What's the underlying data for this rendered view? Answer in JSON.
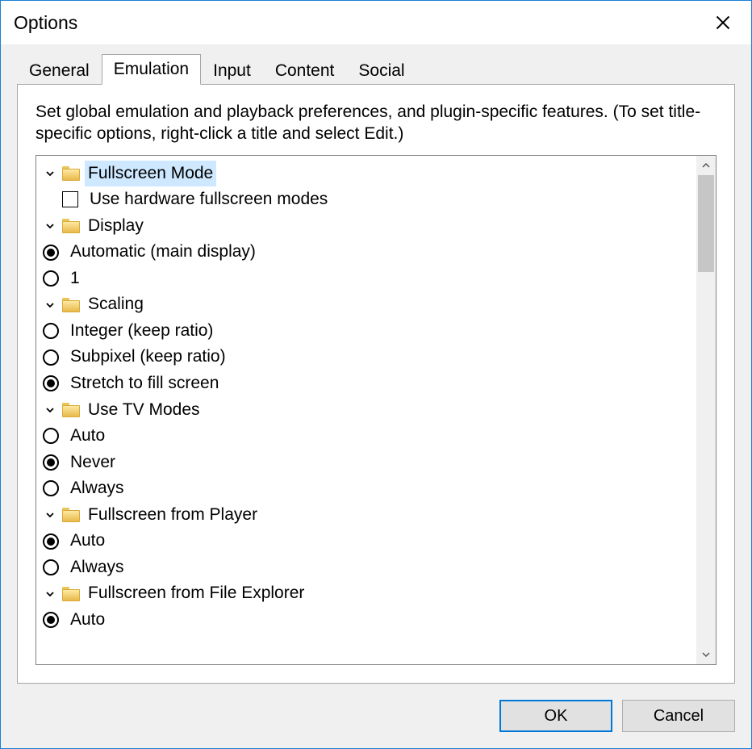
{
  "window": {
    "title": "Options"
  },
  "tabs": {
    "general": "General",
    "emulation": "Emulation",
    "input": "Input",
    "content": "Content",
    "social": "Social"
  },
  "description": "Set global emulation and playback preferences, and plugin-specific features. (To set title-specific options, right-click a title and select Edit.)",
  "tree": {
    "fullscreen_mode": {
      "label": "Fullscreen Mode",
      "use_hw_fullscreen": "Use hardware fullscreen modes",
      "display": {
        "label": "Display",
        "auto": "Automatic (main display)",
        "one": "1"
      },
      "scaling": {
        "label": "Scaling",
        "integer": "Integer (keep ratio)",
        "subpixel": "Subpixel (keep ratio)",
        "stretch": "Stretch to fill screen"
      },
      "tv_modes": {
        "label": "Use TV Modes",
        "auto": "Auto",
        "never": "Never",
        "always": "Always"
      },
      "from_player": {
        "label": "Fullscreen from Player",
        "auto": "Auto",
        "always": "Always"
      },
      "from_explorer": {
        "label": "Fullscreen from File Explorer",
        "auto": "Auto"
      }
    }
  },
  "buttons": {
    "ok": "OK",
    "cancel": "Cancel"
  }
}
